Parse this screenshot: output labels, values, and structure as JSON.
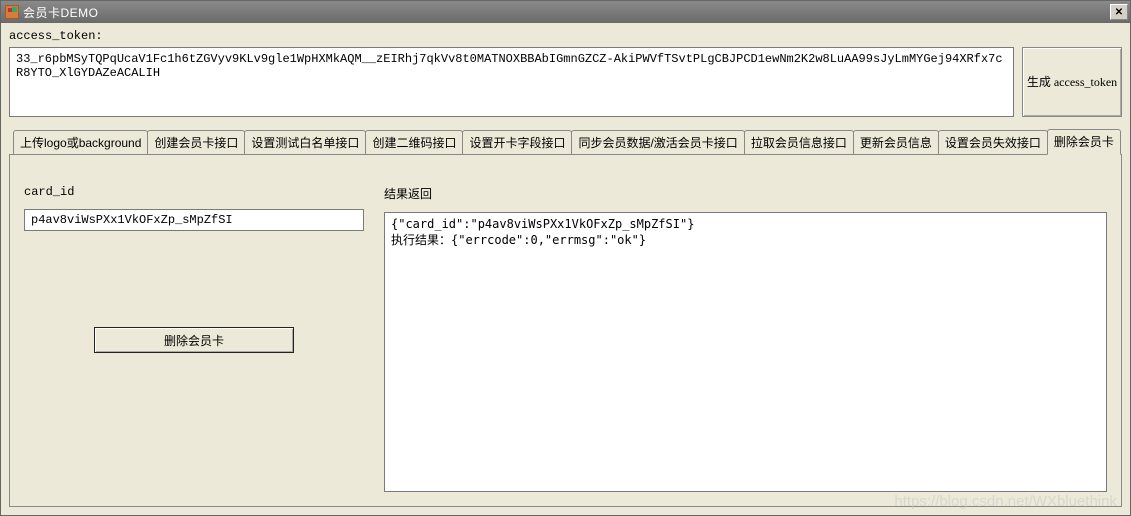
{
  "window": {
    "title": "会员卡DEMO"
  },
  "token": {
    "label": "access_token:",
    "value": "33_r6pbMSyTQPqUcaV1Fc1h6tZGVyv9KLv9gle1WpHXMkAQM__zEIRhj7qkVv8t0MATNOXBBAbIGmnGZCZ-AkiPWVfTSvtPLgCBJPCD1ewNm2K2w8LuAA99sJyLmMYGej94XRfx7cR8YTO_XlGYDAZeACALIH",
    "button": "生成\naccess_token"
  },
  "tabs": {
    "items": [
      "上传logo或background",
      "创建会员卡接口",
      "设置测试白名单接口",
      "创建二维码接口",
      "设置开卡字段接口",
      "同步会员数据/激活会员卡接口",
      "拉取会员信息接口",
      "更新会员信息",
      "设置会员失效接口",
      "删除会员卡"
    ],
    "active_index": 9
  },
  "panel": {
    "card_id_label": "card_id",
    "card_id_value": "p4av8viWsPXx1VkOFxZp_sMpZfSI",
    "delete_button": "删除会员卡",
    "result_label": "结果返回",
    "result_text": "{\"card_id\":\"p4av8viWsPXx1VkOFxZp_sMpZfSI\"}\n执行结果：{\"errcode\":0,\"errmsg\":\"ok\"}"
  },
  "watermark": "https://blog.csdn.net/WXbluethink"
}
